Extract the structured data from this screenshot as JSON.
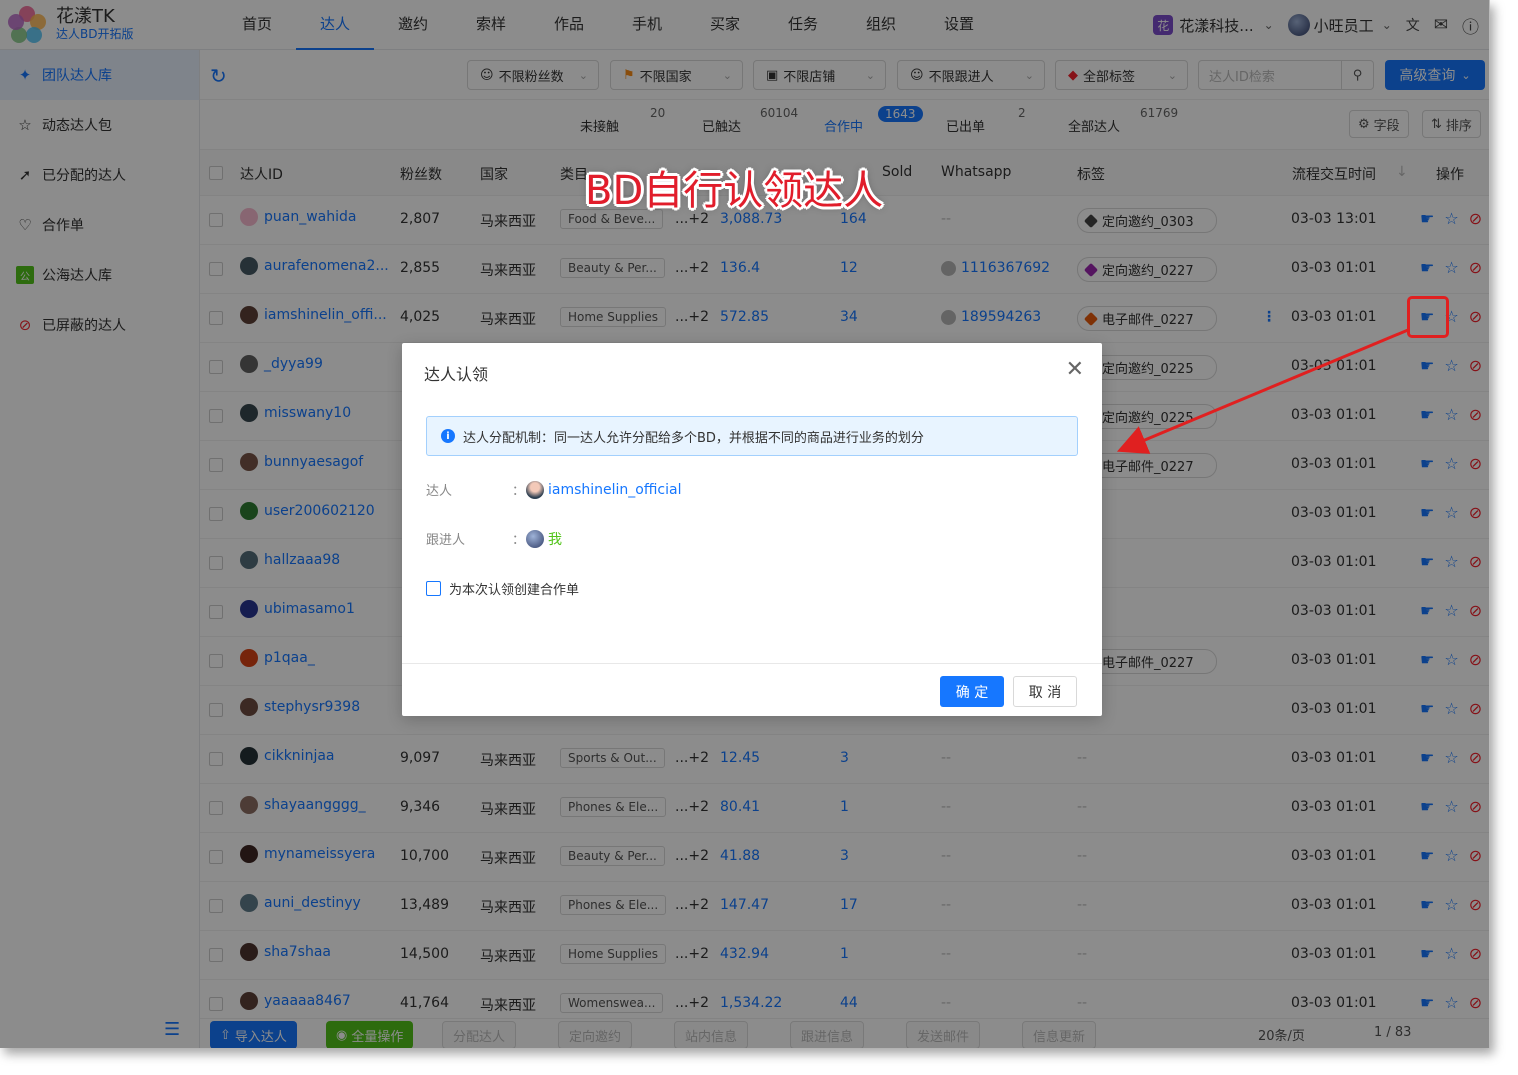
{
  "app": {
    "title": "花漾TK",
    "subtitle": "达人BD开拓版",
    "nav": [
      "首页",
      "达人",
      "邀约",
      "索样",
      "作品",
      "手机",
      "买家",
      "任务",
      "组织",
      "设置"
    ],
    "active_nav": 1,
    "org_badge": "花",
    "org_name": "花漾科技...",
    "user_name": "小旺员工"
  },
  "sidebar": {
    "items": [
      {
        "label": "团队达人库",
        "icon": "team-icon"
      },
      {
        "label": "动态达人包",
        "icon": "star-icon"
      },
      {
        "label": "已分配的达人",
        "icon": "assign-icon"
      },
      {
        "label": "合作单",
        "icon": "handshake-icon"
      },
      {
        "label": "公海达人库",
        "icon": "public-pool-icon"
      },
      {
        "label": "已屏蔽的达人",
        "icon": "blocked-icon"
      }
    ]
  },
  "filters": {
    "fans": "不限粉丝数",
    "country": "不限国家",
    "shop": "不限店铺",
    "follower": "不限跟进人",
    "tags": "全部标签",
    "search_placeholder": "达人ID检索",
    "advanced": "高级查询"
  },
  "status_tabs": [
    {
      "label": "未接触",
      "count": "20"
    },
    {
      "label": "已触达",
      "count": "60104"
    },
    {
      "label": "合作中",
      "count": "1643"
    },
    {
      "label": "已出单",
      "count": "2"
    },
    {
      "label": "全部达人",
      "count": "61769"
    }
  ],
  "tools": {
    "fields": "字段",
    "sort": "排序"
  },
  "table": {
    "headers": [
      "达人ID",
      "粉丝数",
      "国家",
      "类目",
      "Sold",
      "Whatsapp",
      "标签",
      "流程交互时间",
      "操作"
    ],
    "rows": [
      {
        "id": "puan_wahida",
        "fans": "2,807",
        "country": "马来西亚",
        "cat": "Food & Beve...",
        "more": "...+2",
        "gmv": "3,088.73",
        "sold": "164",
        "wa": "--",
        "tag": "定向邀约_0303",
        "tag_color": "#444444",
        "time": "03-03 13:01"
      },
      {
        "id": "aurafenomena2...",
        "fans": "2,855",
        "country": "马来西亚",
        "cat": "Beauty & Per...",
        "more": "...+2",
        "gmv": "136.4",
        "sold": "12",
        "wa": "1116367692",
        "tag": "定向邀约_0227",
        "tag_color": "#9c27b0",
        "time": "03-03 01:01"
      },
      {
        "id": "iamshinelin_offi...",
        "fans": "4,025",
        "country": "马来西亚",
        "cat": "Home Supplies",
        "more": "...+2",
        "gmv": "572.85",
        "sold": "34",
        "wa": "189594263",
        "tag": "电子邮件_0227",
        "tag_color": "#e8590c",
        "time": "03-03 01:01"
      },
      {
        "id": "_dyya99",
        "tag": "定向邀约_0225",
        "time": "03-03 01:01"
      },
      {
        "id": "misswany10",
        "tag": "定向邀约_0225",
        "time": "03-03 01:01"
      },
      {
        "id": "bunnyaesagof",
        "tag": "电子邮件_0227",
        "time": "03-03 01:01"
      },
      {
        "id": "user200602120",
        "time": "03-03 01:01"
      },
      {
        "id": "hallzaaa98",
        "time": "03-03 01:01"
      },
      {
        "id": "ubimasamo1",
        "time": "03-03 01:01"
      },
      {
        "id": "p1qaa_",
        "tag": "电子邮件_0227",
        "time": "03-03 01:01"
      },
      {
        "id": "stephysr9398",
        "time": "03-03 01:01"
      },
      {
        "id": "cikkninjaa",
        "fans": "9,097",
        "country": "马来西亚",
        "cat": "Sports & Out...",
        "more": "...+2",
        "gmv": "12.45",
        "sold": "3",
        "wa": "--",
        "tagtext": "--",
        "time": "03-03 01:01"
      },
      {
        "id": "shayaangggg_",
        "fans": "9,346",
        "country": "马来西亚",
        "cat": "Phones & Ele...",
        "more": "...+2",
        "gmv": "80.41",
        "sold": "1",
        "wa": "--",
        "tagtext": "--",
        "time": "03-03 01:01"
      },
      {
        "id": "mynameissyera",
        "fans": "10,700",
        "country": "马来西亚",
        "cat": "Beauty & Per...",
        "more": "...+2",
        "gmv": "41.88",
        "sold": "3",
        "wa": "--",
        "tagtext": "--",
        "time": "03-03 01:01"
      },
      {
        "id": "auni_destinyy",
        "fans": "13,489",
        "country": "马来西亚",
        "cat": "Phones & Ele...",
        "more": "...+2",
        "gmv": "147.47",
        "sold": "17",
        "wa": "--",
        "tagtext": "--",
        "time": "03-03 01:01"
      },
      {
        "id": "sha7shaa",
        "fans": "14,500",
        "country": "马来西亚",
        "cat": "Home Supplies",
        "more": "...+2",
        "gmv": "432.94",
        "sold": "1",
        "wa": "--",
        "tagtext": "--",
        "time": "03-03 01:01"
      },
      {
        "id": "yaaaaa8467",
        "fans": "41,764",
        "country": "马来西亚",
        "cat": "Womenswea...",
        "more": "...+2",
        "gmv": "1,534.22",
        "sold": "44",
        "wa": "--",
        "tagtext": "--",
        "time": "03-03 01:01"
      }
    ]
  },
  "bottom": {
    "import": "导入达人",
    "batch": "全量操作",
    "b3": "分配达人",
    "b4": "定向邀约",
    "b5": "站内信息",
    "b6": "跟进信息",
    "b7": "发送邮件",
    "b8": "信息更新",
    "per_page": "20条/页",
    "page": "1 / 83"
  },
  "dialog": {
    "title": "达人认领",
    "notice": "达人分配机制：同一达人允许分配给多个BD，并根据不同的商品进行业务的划分",
    "creator_label": "达人",
    "creator_value": "iamshinelin_official",
    "follower_label": "跟进人",
    "follower_value": "我",
    "colon": "：",
    "checkbox_label": "为本次认领创建合作单",
    "ok": "确 定",
    "cancel": "取 消"
  },
  "annotation": {
    "title": "BD自行认领达人"
  },
  "colors": {
    "primary": "#1677ff",
    "annotation": "#e11d2b"
  }
}
